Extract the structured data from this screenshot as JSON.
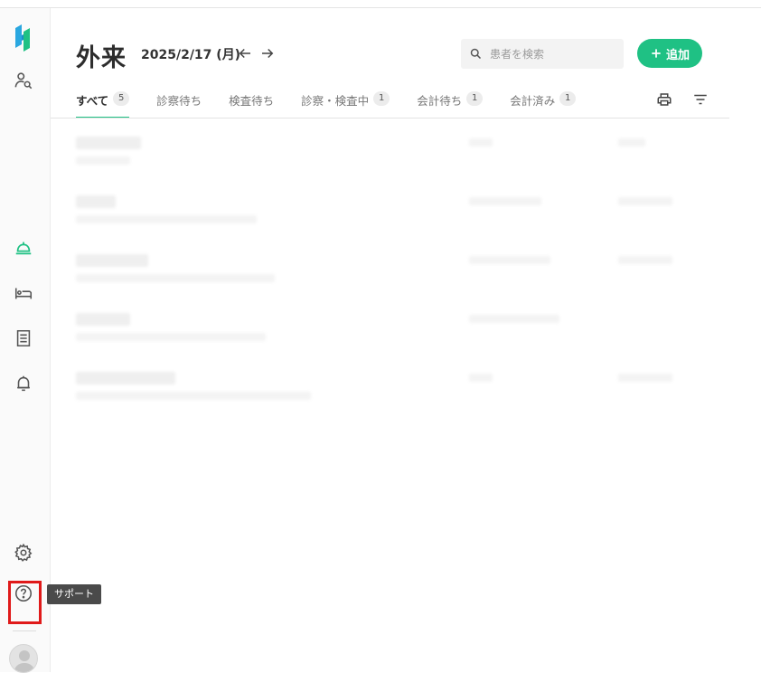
{
  "header": {
    "title": "外来",
    "date": "2025/2/17 (月)"
  },
  "search": {
    "placeholder": "患者を検索"
  },
  "toolbar": {
    "add_label": "追加"
  },
  "tabs": [
    {
      "label": "すべて",
      "count": "5",
      "active": true
    },
    {
      "label": "診察待ち",
      "count": ""
    },
    {
      "label": "検査待ち",
      "count": ""
    },
    {
      "label": "診察・検査中",
      "count": "1"
    },
    {
      "label": "会計待ち",
      "count": "1"
    },
    {
      "label": "会計済み",
      "count": "1"
    }
  ],
  "sidebar": {
    "tooltip": "サポート",
    "icons": [
      "patient-search-icon",
      "outpatient-icon",
      "bed-icon",
      "receipt-icon",
      "bell-icon",
      "gear-icon",
      "help-icon"
    ]
  },
  "colors": {
    "accent": "#1fc184",
    "highlight": "#e01a1a"
  }
}
